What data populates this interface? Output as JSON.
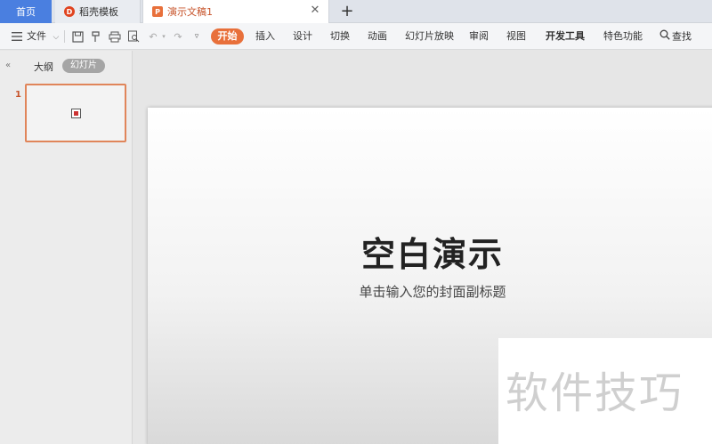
{
  "tabs": {
    "home": "首页",
    "docer": "稻壳模板",
    "document": "演示文稿1",
    "close_icon": "close-icon",
    "add_icon": "plus-icon"
  },
  "toolbar": {
    "menu_icon": "menu-icon",
    "file": "文件",
    "icons": [
      "save-icon",
      "format-painter-icon",
      "print-icon",
      "print-preview-icon",
      "undo-icon",
      "redo-icon",
      "customize-icon"
    ],
    "menus": {
      "start": "开始",
      "insert": "插入",
      "design": "设计",
      "transition": "切换",
      "animation": "动画",
      "slideshow": "幻灯片放映",
      "review": "审阅",
      "view": "视图",
      "developer": "开发工具",
      "special": "特色功能",
      "search": "查找"
    },
    "accent": "#e8703b"
  },
  "sidebar": {
    "outline": "大纲",
    "slides": "幻灯片",
    "slide_number": "1"
  },
  "slide": {
    "title": "空白演示",
    "subtitle": "单击输入您的封面副标题"
  },
  "watermark": {
    "text": "软件技巧"
  }
}
